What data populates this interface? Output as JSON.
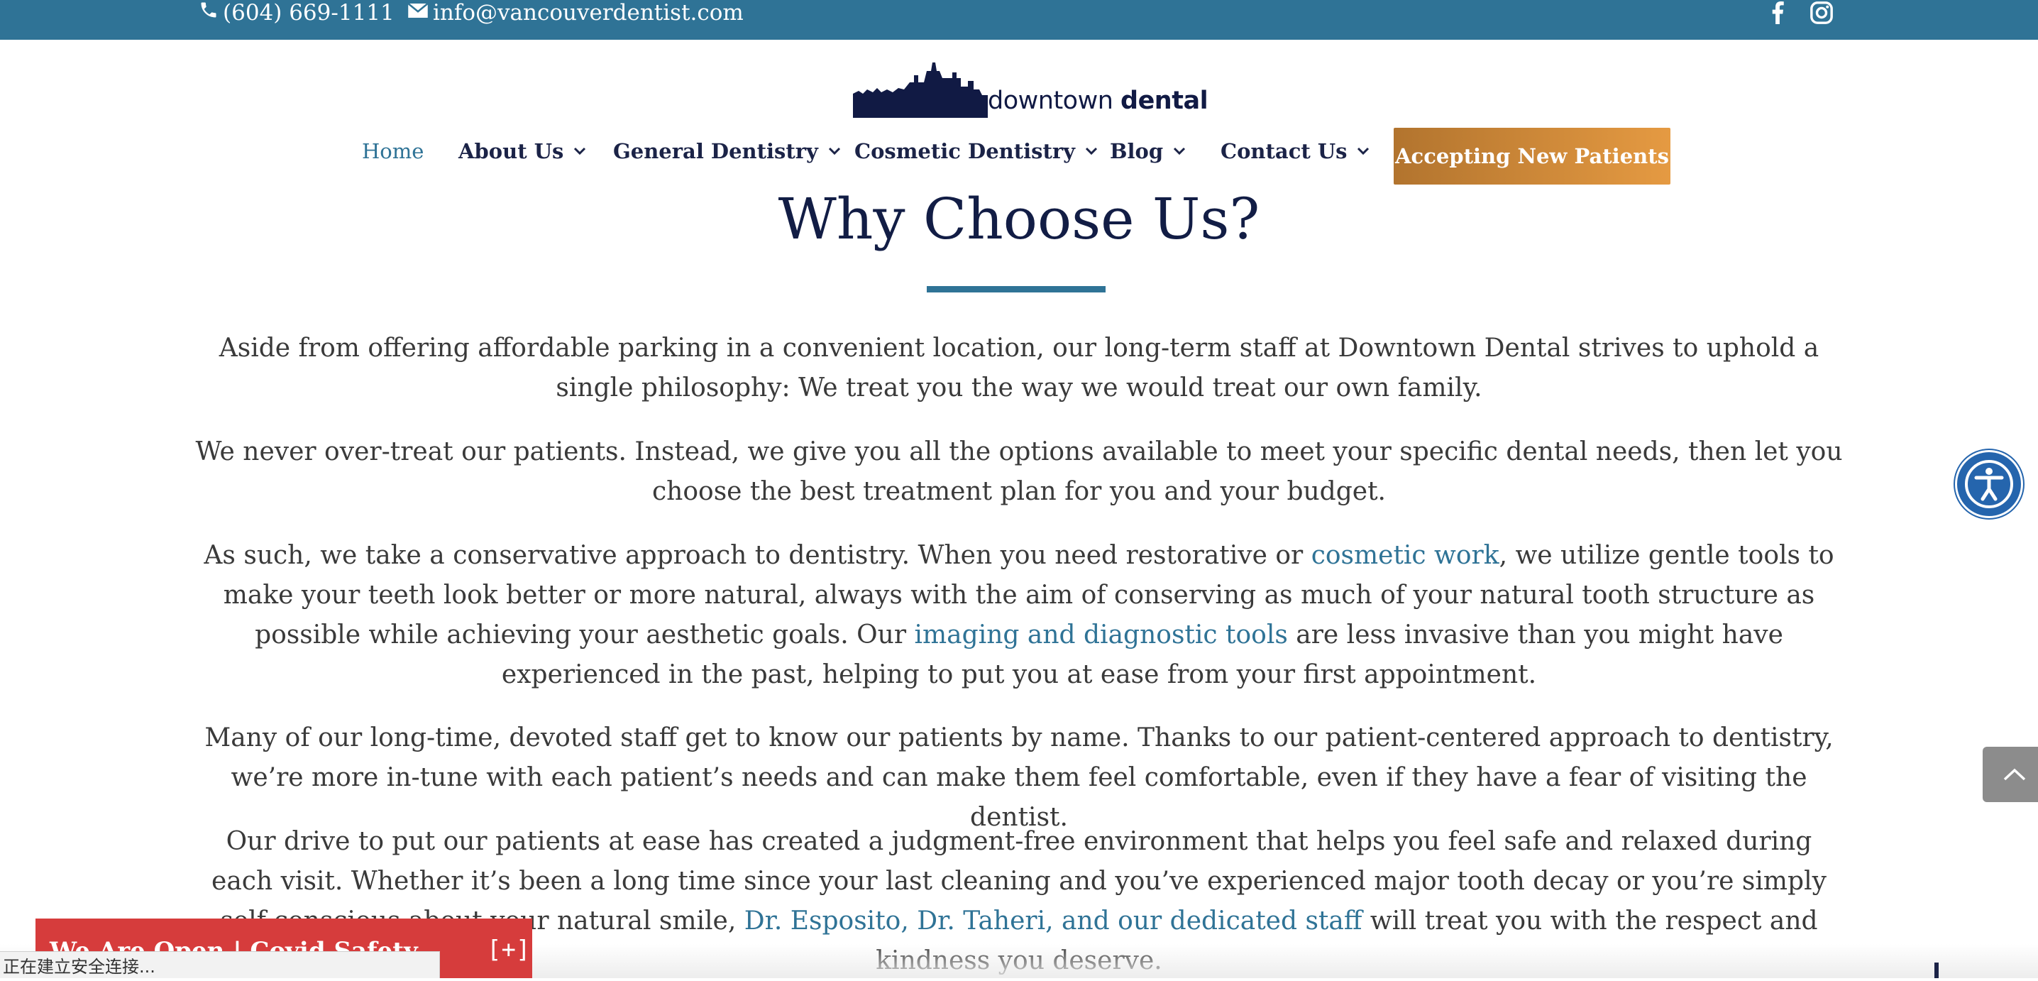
{
  "topbar": {
    "phone": "(604) 669-1111",
    "email": "info@vancouverdentist.com",
    "social": [
      "facebook-icon",
      "instagram-icon"
    ]
  },
  "logo": {
    "text_light": "downtown ",
    "text_bold": "dental"
  },
  "nav": {
    "items": [
      {
        "label": "Home",
        "active": true,
        "dropdown": false
      },
      {
        "label": "About Us",
        "dropdown": true
      },
      {
        "label": "General Dentistry",
        "dropdown": true
      },
      {
        "label": "Cosmetic Dentistry",
        "dropdown": true
      },
      {
        "label": "Blog",
        "dropdown": true
      },
      {
        "label": "Contact Us",
        "dropdown": true
      }
    ],
    "cta": "Accepting New Patients"
  },
  "main": {
    "heading": "Why Choose Us?",
    "p1": "Aside from offering affordable parking in a convenient location, our long-term staff at Downtown Dental strives to uphold a single philosophy: We treat you the way we would treat our own family.",
    "p2": "We never over-treat our patients. Instead, we give you all the options available to meet your specific dental needs, then let you choose the best treatment plan for you and your budget.",
    "p3": {
      "t1": "As such, we take a conservative approach to dentistry. When you need restorative or ",
      "link1": "cosmetic work",
      "t2": ", we utilize gentle tools to make your teeth look better or more natural, always with the aim of conserving as much of your natural tooth structure as possible while achieving your aesthetic goals. Our ",
      "link2": "imaging and diagnostic tools",
      "t3": " are less invasive than you might have experienced in the past, helping to put you at ease from your first appointment."
    },
    "p4": "Many of our long-time, devoted staff get to know our patients by name. Thanks to our patient-centered approach to dentistry, we’re more in-tune with each patient’s needs and can make them feel comfortable, even if they have a fear of visiting the dentist.",
    "p5": {
      "t1": "Our drive to put our patients at ease has created a judgment-free environment that helps you feel safe and relaxed during each visit. Whether it’s been a long time since your last cleaning and you’ve experienced major tooth decay or you’re simply self-conscious about your natural smile, ",
      "link1": "Dr. Esposito, Dr. Taheri, and our dedicated staff",
      "t2": " will treat you with the respect and kindness you deserve."
    }
  },
  "notice": {
    "text": "We Are Open | Covid Safety",
    "toggle": "[+]"
  },
  "statusbar": {
    "text": "正在建立安全连接..."
  },
  "colors": {
    "brand_blue": "#2f7396",
    "navy": "#121d45",
    "cta_start": "#b2742e",
    "cta_end": "#e59a42",
    "notice_red": "#d63c3c"
  }
}
